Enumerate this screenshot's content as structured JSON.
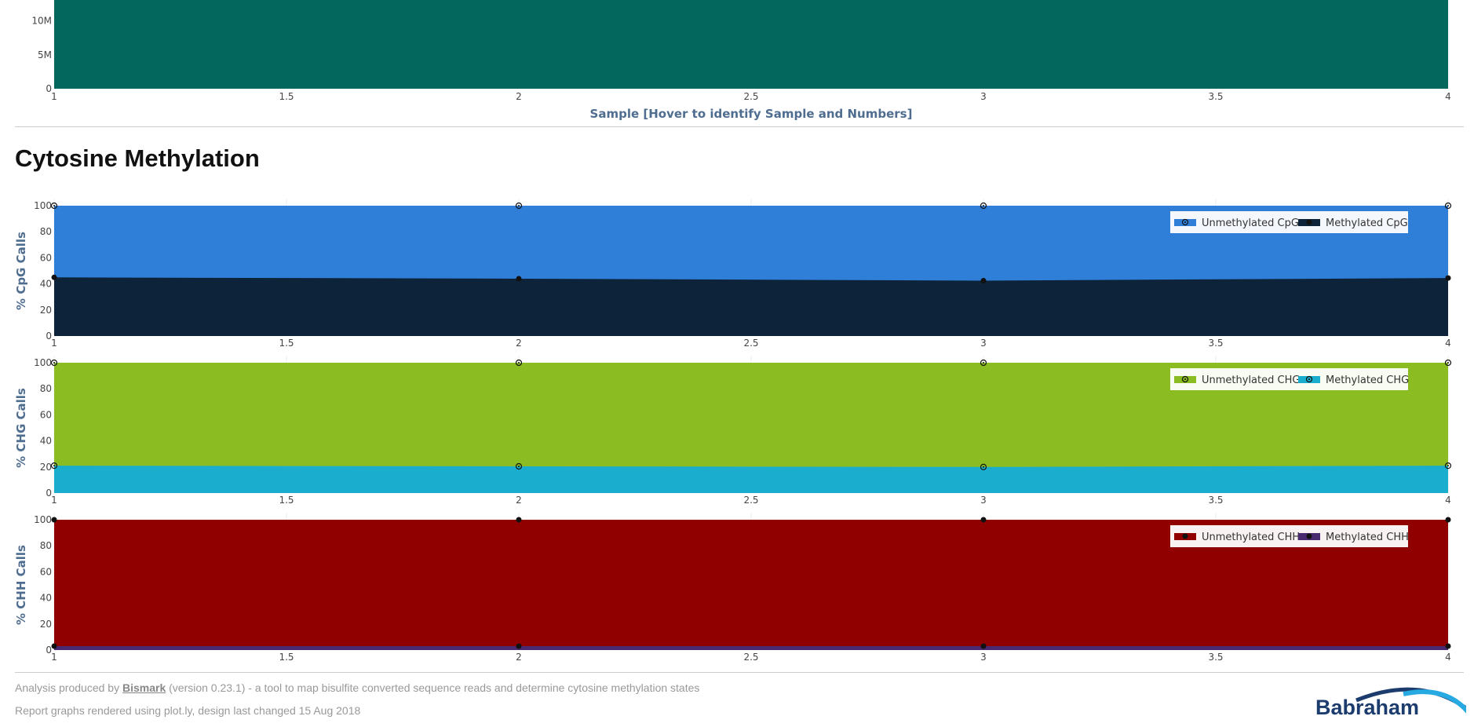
{
  "section_title": "Cytosine Methylation",
  "chart_data": [
    {
      "type": "area",
      "x": [
        1,
        2,
        3,
        4
      ],
      "xlim": [
        1,
        4
      ],
      "x_ticks": [
        "1",
        "1.5",
        "2",
        "2.5",
        "3",
        "3.5",
        "4"
      ],
      "y_ticks_visible": [
        "0",
        "5M",
        "10M"
      ],
      "xlabel": "Sample [Hover to identify Sample and Numbers]",
      "ylabel": "",
      "grid": true,
      "series": [
        {
          "color": "#04675e",
          "values": [
            16000000,
            16000000,
            16000000,
            16000000
          ]
        }
      ]
    },
    {
      "type": "area",
      "x": [
        1,
        2,
        3,
        4
      ],
      "xlim": [
        1,
        4
      ],
      "ylim": [
        0,
        100
      ],
      "x_ticks": [
        "1",
        "1.5",
        "2",
        "2.5",
        "3",
        "3.5",
        "4"
      ],
      "y_ticks": [
        "0",
        "20",
        "40",
        "60",
        "80",
        "100"
      ],
      "ylabel": "% CpG Calls",
      "legend_position": "top-right",
      "series": [
        {
          "name": "Unmethylated CpG",
          "color": "#2f7ed8",
          "marker": "open-circle",
          "values": [
            100,
            100,
            100,
            100
          ]
        },
        {
          "name": "Methylated CpG",
          "color": "#0d233a",
          "marker": "filled-circle",
          "values": [
            45,
            44,
            42.5,
            44.5
          ]
        }
      ]
    },
    {
      "type": "area",
      "x": [
        1,
        2,
        3,
        4
      ],
      "xlim": [
        1,
        4
      ],
      "ylim": [
        0,
        100
      ],
      "x_ticks": [
        "1",
        "1.5",
        "2",
        "2.5",
        "3",
        "3.5",
        "4"
      ],
      "y_ticks": [
        "0",
        "20",
        "40",
        "60",
        "80",
        "100"
      ],
      "ylabel": "% CHG Calls",
      "legend_position": "top-right",
      "series": [
        {
          "name": "Unmethylated CHG",
          "color": "#8bbc21",
          "marker": "open-circle",
          "values": [
            100,
            100,
            100,
            100
          ]
        },
        {
          "name": "Methylated CHG",
          "color": "#1aadce",
          "marker": "open-circle",
          "values": [
            21,
            20.5,
            20,
            21
          ]
        }
      ]
    },
    {
      "type": "area",
      "x": [
        1,
        2,
        3,
        4
      ],
      "xlim": [
        1,
        4
      ],
      "ylim": [
        0,
        100
      ],
      "x_ticks": [
        "1",
        "1.5",
        "2",
        "2.5",
        "3",
        "3.5",
        "4"
      ],
      "y_ticks": [
        "0",
        "20",
        "40",
        "60",
        "80",
        "100"
      ],
      "ylabel": "% CHH Calls",
      "legend_position": "top-right",
      "series": [
        {
          "name": "Unmethylated CHH",
          "color": "#910000",
          "marker": "filled-circle",
          "values": [
            100,
            100,
            100,
            100
          ]
        },
        {
          "name": "Methylated CHH",
          "color": "#492970",
          "marker": "filled-circle",
          "values": [
            3,
            3,
            3,
            3
          ]
        }
      ]
    }
  ],
  "footer": {
    "line1_prefix": "Analysis produced by ",
    "line1_link": "Bismark",
    "line1_suffix": " (version 0.23.1) - a tool to map bisulfite converted sequence reads and determine cytosine methylation states",
    "line2": "Report graphs rendered using plot.ly, design last changed 15 Aug 2018"
  },
  "logo": {
    "text": "Babraham"
  }
}
